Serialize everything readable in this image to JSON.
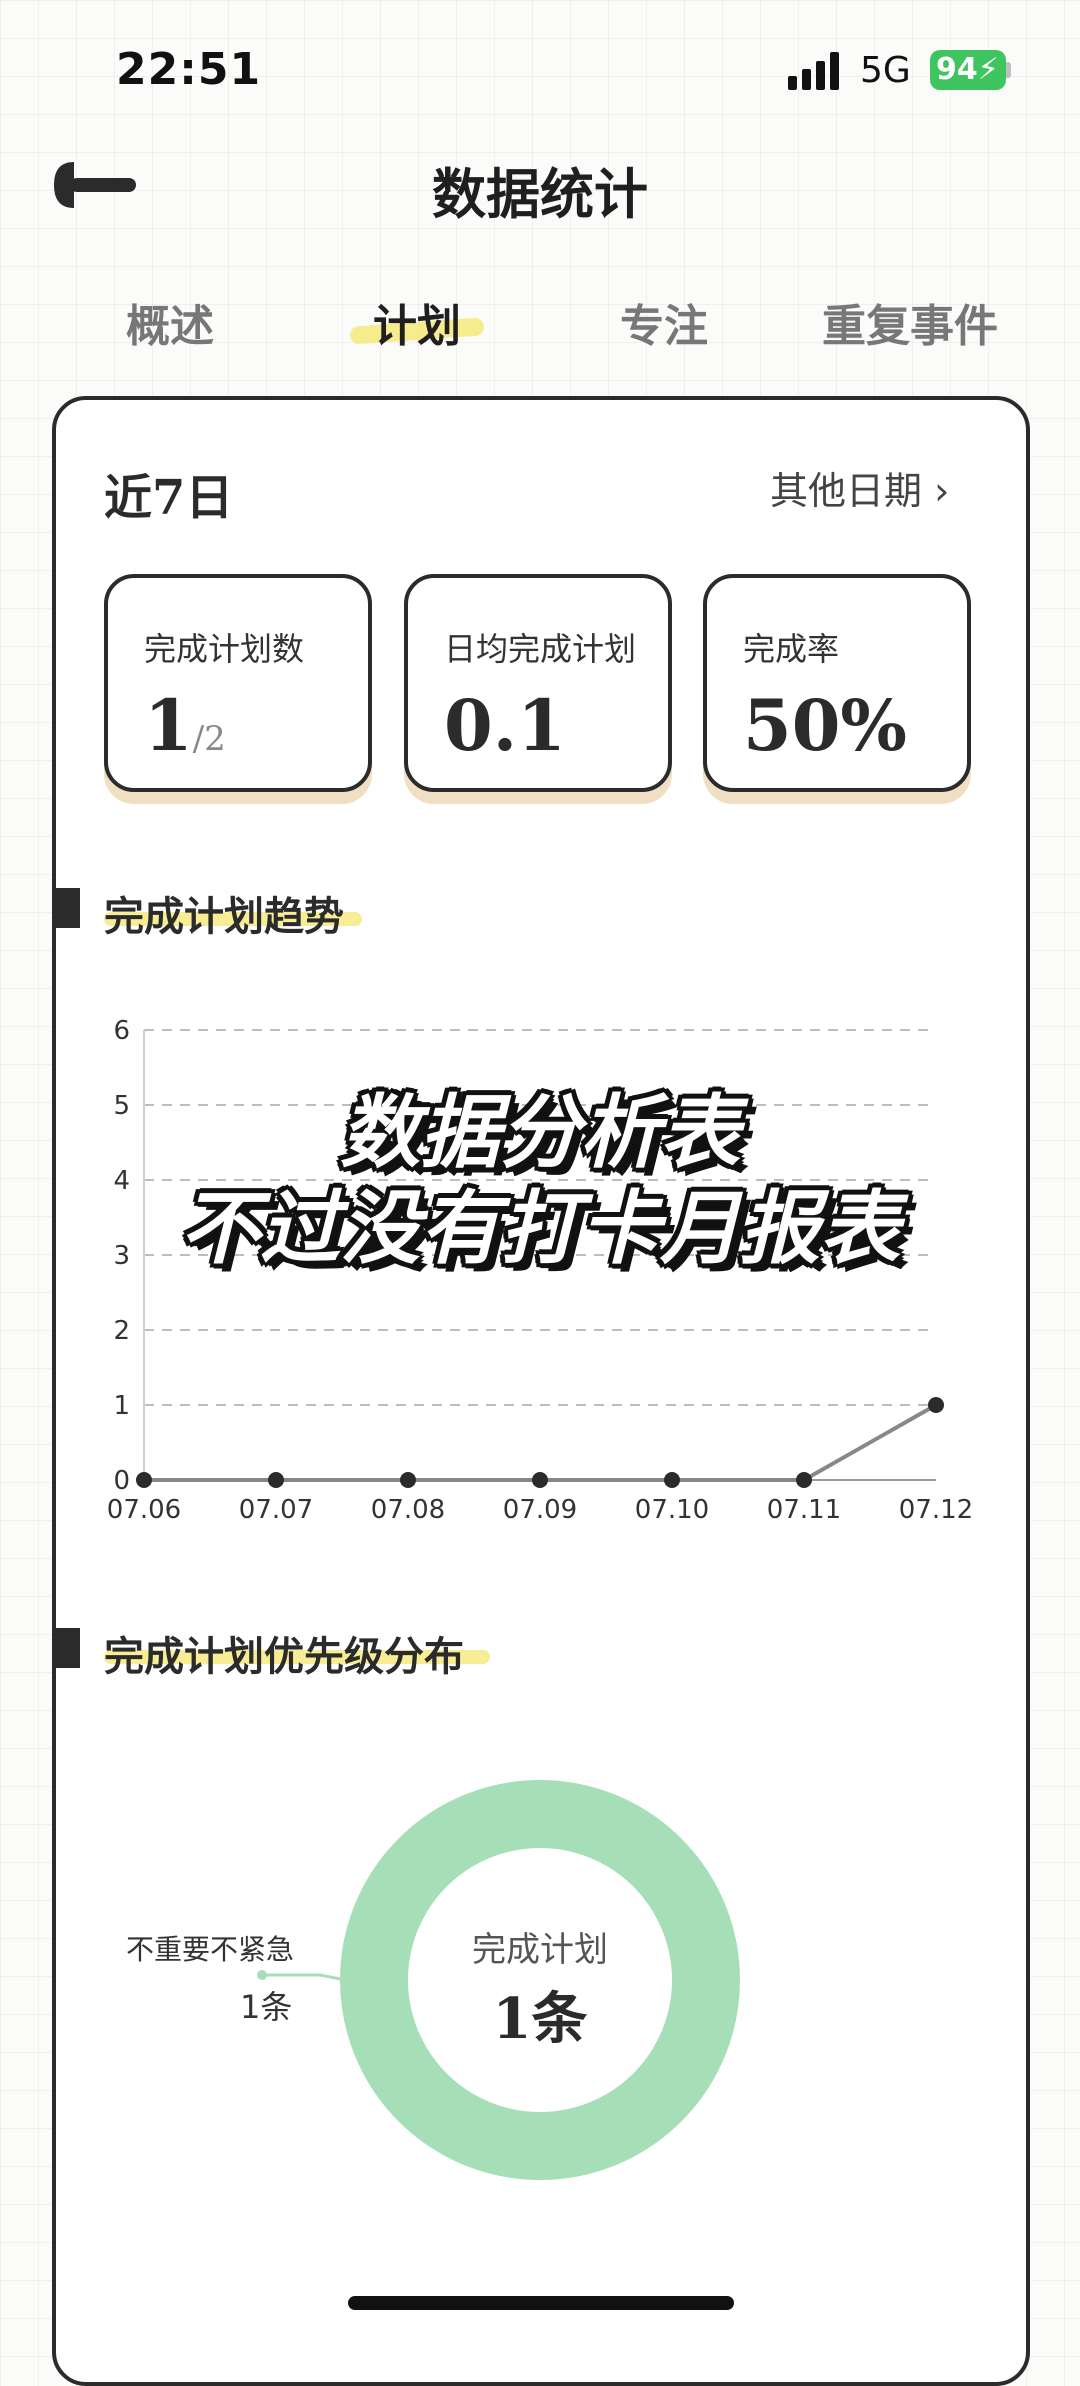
{
  "status_bar": {
    "time": "22:51",
    "network": "5G",
    "battery": "94"
  },
  "header": {
    "title": "数据统计",
    "back_icon": "back-arrow-icon"
  },
  "tabs": [
    {
      "label": "概述",
      "active": false
    },
    {
      "label": "计划",
      "active": true
    },
    {
      "label": "专注",
      "active": false
    },
    {
      "label": "重复事件",
      "active": false
    }
  ],
  "card": {
    "range_title": "近7日",
    "other_dates": "其他日期 ›",
    "stats": [
      {
        "label": "完成计划数",
        "value": "1",
        "suffix": "/2"
      },
      {
        "label": "日均完成计划",
        "value": "0.1",
        "suffix": ""
      },
      {
        "label": "完成率",
        "value": "50%",
        "suffix": ""
      }
    ]
  },
  "trend": {
    "title": "完成计划趋势",
    "chart_data": {
      "type": "line",
      "categories": [
        "07.06",
        "07.07",
        "07.08",
        "07.09",
        "07.10",
        "07.11",
        "07.12"
      ],
      "values": [
        0,
        0,
        0,
        0,
        0,
        0,
        1
      ],
      "y_ticks": [
        "0",
        "1",
        "2",
        "3",
        "4",
        "5",
        "6"
      ],
      "ylim": [
        0,
        6
      ],
      "grid": "dashed horizontal",
      "line_color": "#888888",
      "point_color": "#2b2b2b"
    }
  },
  "overlay": {
    "line1": "数据分析表",
    "line2": "不过没有打卡月报表"
  },
  "priority": {
    "title": "完成计划优先级分布",
    "center_label": "完成计划",
    "center_value": "1条",
    "chart_data": {
      "type": "pie",
      "slices": [
        {
          "name": "不重要不紧急",
          "value": 1,
          "label": "1条",
          "color": "#a6dfb7"
        }
      ]
    }
  }
}
